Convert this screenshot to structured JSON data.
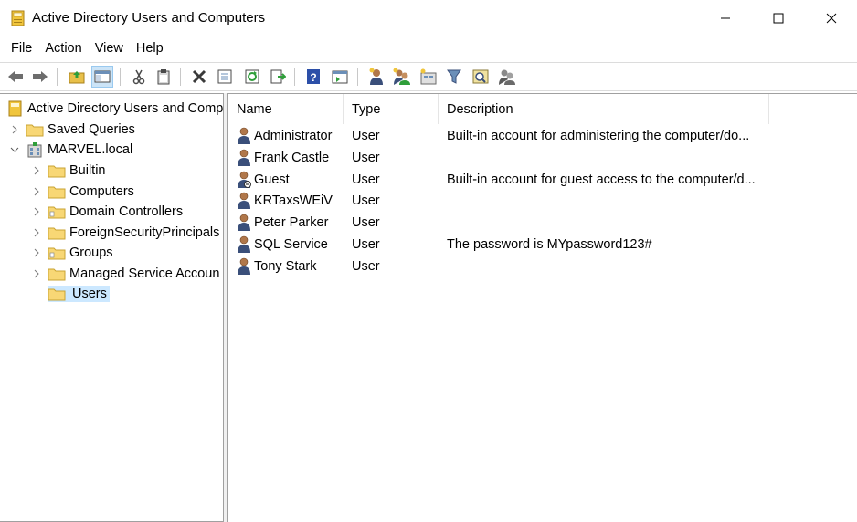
{
  "window": {
    "title": "Active Directory Users and Computers"
  },
  "menu": [
    "File",
    "Action",
    "View",
    "Help"
  ],
  "toolbar": {
    "buttons": [
      "back-icon",
      "forward-icon",
      "up-folder-icon",
      "show-hide-tree-icon",
      "cut-icon",
      "paste-icon",
      "delete-icon",
      "properties-icon",
      "refresh-icon",
      "export-list-icon",
      "help-icon",
      "action-pane-icon",
      "new-user-icon",
      "new-group-icon",
      "new-ou-icon",
      "filter-icon",
      "find-icon",
      "add-to-group-icon"
    ]
  },
  "tree": {
    "root": "Active Directory Users and Comp",
    "saved_queries": "Saved Queries",
    "domain": "MARVEL.local",
    "children": [
      "Builtin",
      "Computers",
      "Domain Controllers",
      "ForeignSecurityPrincipals",
      "Groups",
      "Managed Service Accoun",
      "Users"
    ],
    "selected": "Users"
  },
  "list": {
    "columns": [
      "Name",
      "Type",
      "Description"
    ],
    "rows": [
      {
        "name": "Administrator",
        "type": "User",
        "description": "Built-in account for administering the computer/do...",
        "icon": "user-icon"
      },
      {
        "name": "Frank Castle",
        "type": "User",
        "description": "",
        "icon": "user-icon"
      },
      {
        "name": "Guest",
        "type": "User",
        "description": "Built-in account for guest access to the computer/d...",
        "icon": "disabled-user-icon"
      },
      {
        "name": "KRTaxsWEiV",
        "type": "User",
        "description": "",
        "icon": "user-icon"
      },
      {
        "name": "Peter Parker",
        "type": "User",
        "description": "",
        "icon": "user-icon"
      },
      {
        "name": "SQL Service",
        "type": "User",
        "description": "The password is MYpassword123#",
        "icon": "user-icon"
      },
      {
        "name": "Tony Stark",
        "type": "User",
        "description": "",
        "icon": "user-icon"
      }
    ]
  },
  "colors": {
    "selection": "#cce8ff",
    "toolbar_active": "#cce4f7",
    "folder": "#f8d775",
    "border": "#a0a0a0"
  }
}
